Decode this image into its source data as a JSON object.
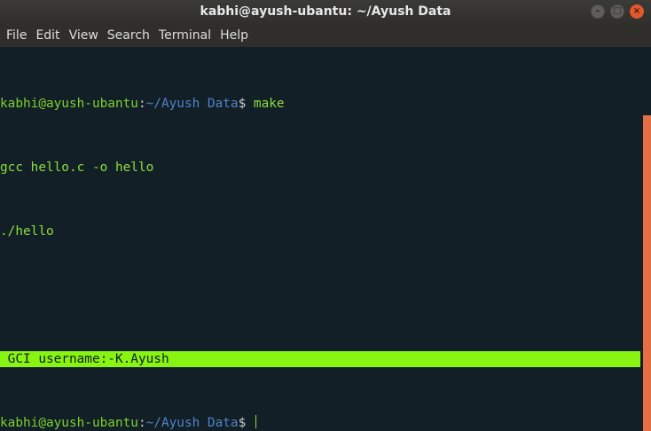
{
  "window": {
    "title": "kabhi@ayush-ubantu: ~/Ayush Data",
    "controls": {
      "minimize_glyph": "–",
      "maximize_glyph": "□",
      "close_glyph": "×"
    }
  },
  "menubar": {
    "items": [
      "File",
      "Edit",
      "View",
      "Search",
      "Terminal",
      "Help"
    ]
  },
  "terminal": {
    "prompt_user_host": "kabhi@ayush-ubantu",
    "prompt_colon": ":",
    "prompt_path": "~/Ayush Data",
    "prompt_sign": "$",
    "lines": [
      {
        "type": "prompt",
        "command": " make"
      },
      {
        "type": "output",
        "text": "gcc hello.c -o hello"
      },
      {
        "type": "output",
        "text": "./hello"
      },
      {
        "type": "blank",
        "text": ""
      },
      {
        "type": "highlight",
        "text": " GCI username:-K.Ayush"
      },
      {
        "type": "prompt",
        "command": " "
      }
    ]
  },
  "colors": {
    "background": "#131f27",
    "user_host": "#7bd02c",
    "path": "#4f83c8",
    "output": "#8ade3a",
    "highlight_bg": "#88f411",
    "scroll_thumb": "#e46f45",
    "close_button": "#e2582d"
  },
  "icons": {
    "minimize": "minimize-icon",
    "maximize": "maximize-icon",
    "close": "close-icon"
  }
}
